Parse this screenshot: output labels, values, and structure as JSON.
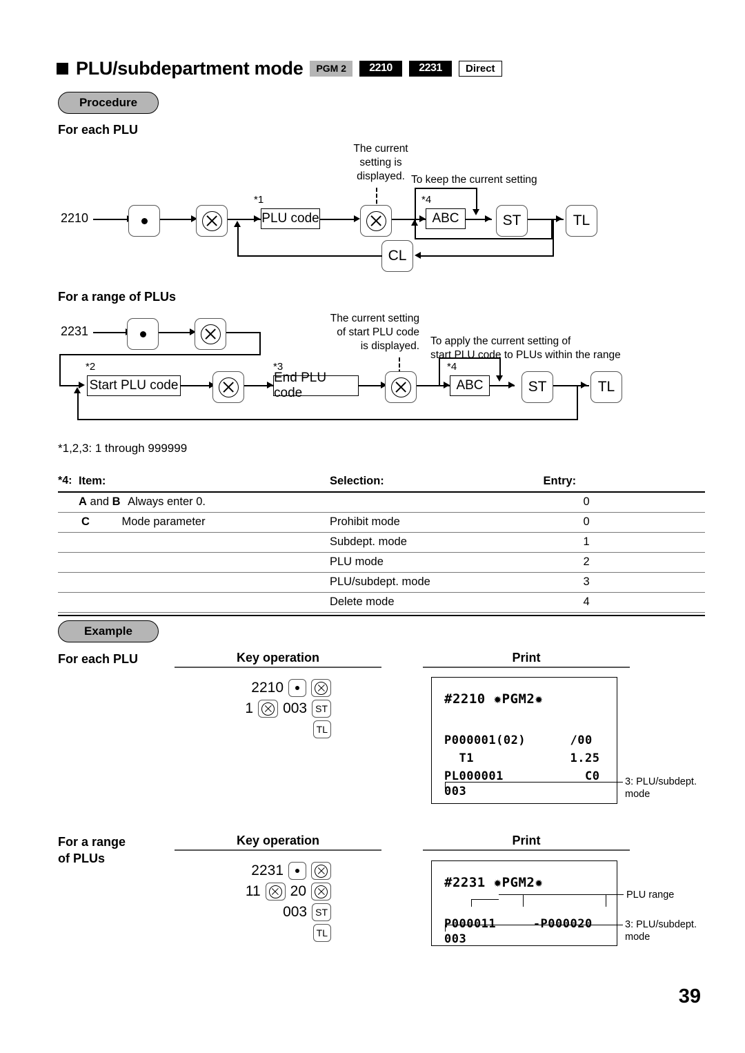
{
  "header": {
    "title": "PLU/subdepartment mode",
    "badges": [
      {
        "label": "PGM 2",
        "style": "gray"
      },
      {
        "label": "2210",
        "style": "black"
      },
      {
        "label": "2231",
        "style": "black"
      },
      {
        "label": "Direct",
        "style": "outline"
      }
    ]
  },
  "procedure": {
    "pill": "Procedure",
    "section1": {
      "heading": "For each PLU",
      "start_code": "2210",
      "note_display": "The current\nsetting is\ndisplayed.",
      "note_keep": "To keep the current setting",
      "ref1": "*1",
      "ref4": "*4",
      "box_plu_code": "PLU code",
      "key_abc": "ABC",
      "key_st": "ST",
      "key_tl": "TL",
      "key_cl": "CL"
    },
    "section2": {
      "heading": "For a range of PLUs",
      "start_code": "2231",
      "note_display": "The current setting\nof start PLU code\nis displayed.",
      "note_apply": "To apply the current setting of\nstart PLU code to PLUs within the range",
      "ref2": "*2",
      "ref3": "*3",
      "ref4": "*4",
      "box_start_code": "Start PLU code",
      "box_end_code": "End PLU code",
      "key_abc": "ABC",
      "key_st": "ST",
      "key_tl": "TL"
    },
    "range_note": "*1,2,3: 1 through 999999"
  },
  "table": {
    "ref": "*4:",
    "headers": [
      "Item:",
      "Selection:",
      "Entry:"
    ],
    "rows": [
      {
        "item_bold": "A",
        "item_mid": "and",
        "item_bold2": "B",
        "item_text": "Always enter 0.",
        "selection": "",
        "entry": "0"
      },
      {
        "item_bold": "C",
        "item_mid": "",
        "item_bold2": "",
        "item_text": "Mode parameter",
        "selection": "Prohibit mode",
        "entry": "0"
      },
      {
        "item_bold": "",
        "item_mid": "",
        "item_bold2": "",
        "item_text": "",
        "selection": "Subdept. mode",
        "entry": "1"
      },
      {
        "item_bold": "",
        "item_mid": "",
        "item_bold2": "",
        "item_text": "",
        "selection": "PLU mode",
        "entry": "2"
      },
      {
        "item_bold": "",
        "item_mid": "",
        "item_bold2": "",
        "item_text": "",
        "selection": "PLU/subdept. mode",
        "entry": "3"
      },
      {
        "item_bold": "",
        "item_mid": "",
        "item_bold2": "",
        "item_text": "",
        "selection": "Delete mode",
        "entry": "4"
      }
    ]
  },
  "example": {
    "pill": "Example",
    "case1": {
      "label": "For each PLU",
      "key_operation_header": "Key operation",
      "print_header": "Print",
      "keys_line1_digits": "2210",
      "keys_line2_digit_a": "1",
      "keys_line2_digit_b": "003",
      "key_st": "ST",
      "key_tl": "TL",
      "receipt_lines": [
        "#2210 ✹PGM2✹",
        "",
        "P000001(02)      /00",
        "  T1             1.25",
        "PL000001           C0",
        "003"
      ],
      "annotation": "3: PLU/subdept.\nmode"
    },
    "case2": {
      "label": "For a range\nof PLUs",
      "key_operation_header": "Key operation",
      "print_header": "Print",
      "keys_line1_digits": "2231",
      "keys_line2_digit_a": "11",
      "keys_line2_digit_b": "20",
      "keys_line3_digit": "003",
      "key_st": "ST",
      "key_tl": "TL",
      "receipt_lines": [
        "#2231 ✹PGM2✹",
        "",
        "P000011     -P000020",
        "003"
      ],
      "annotation_range": "PLU range",
      "annotation_mode": "3: PLU/subdept.\nmode"
    }
  },
  "page_number": "39",
  "colors": {
    "pill_fill": "#b5b5b5",
    "badge_black": "#000000",
    "rule": "#555555"
  }
}
